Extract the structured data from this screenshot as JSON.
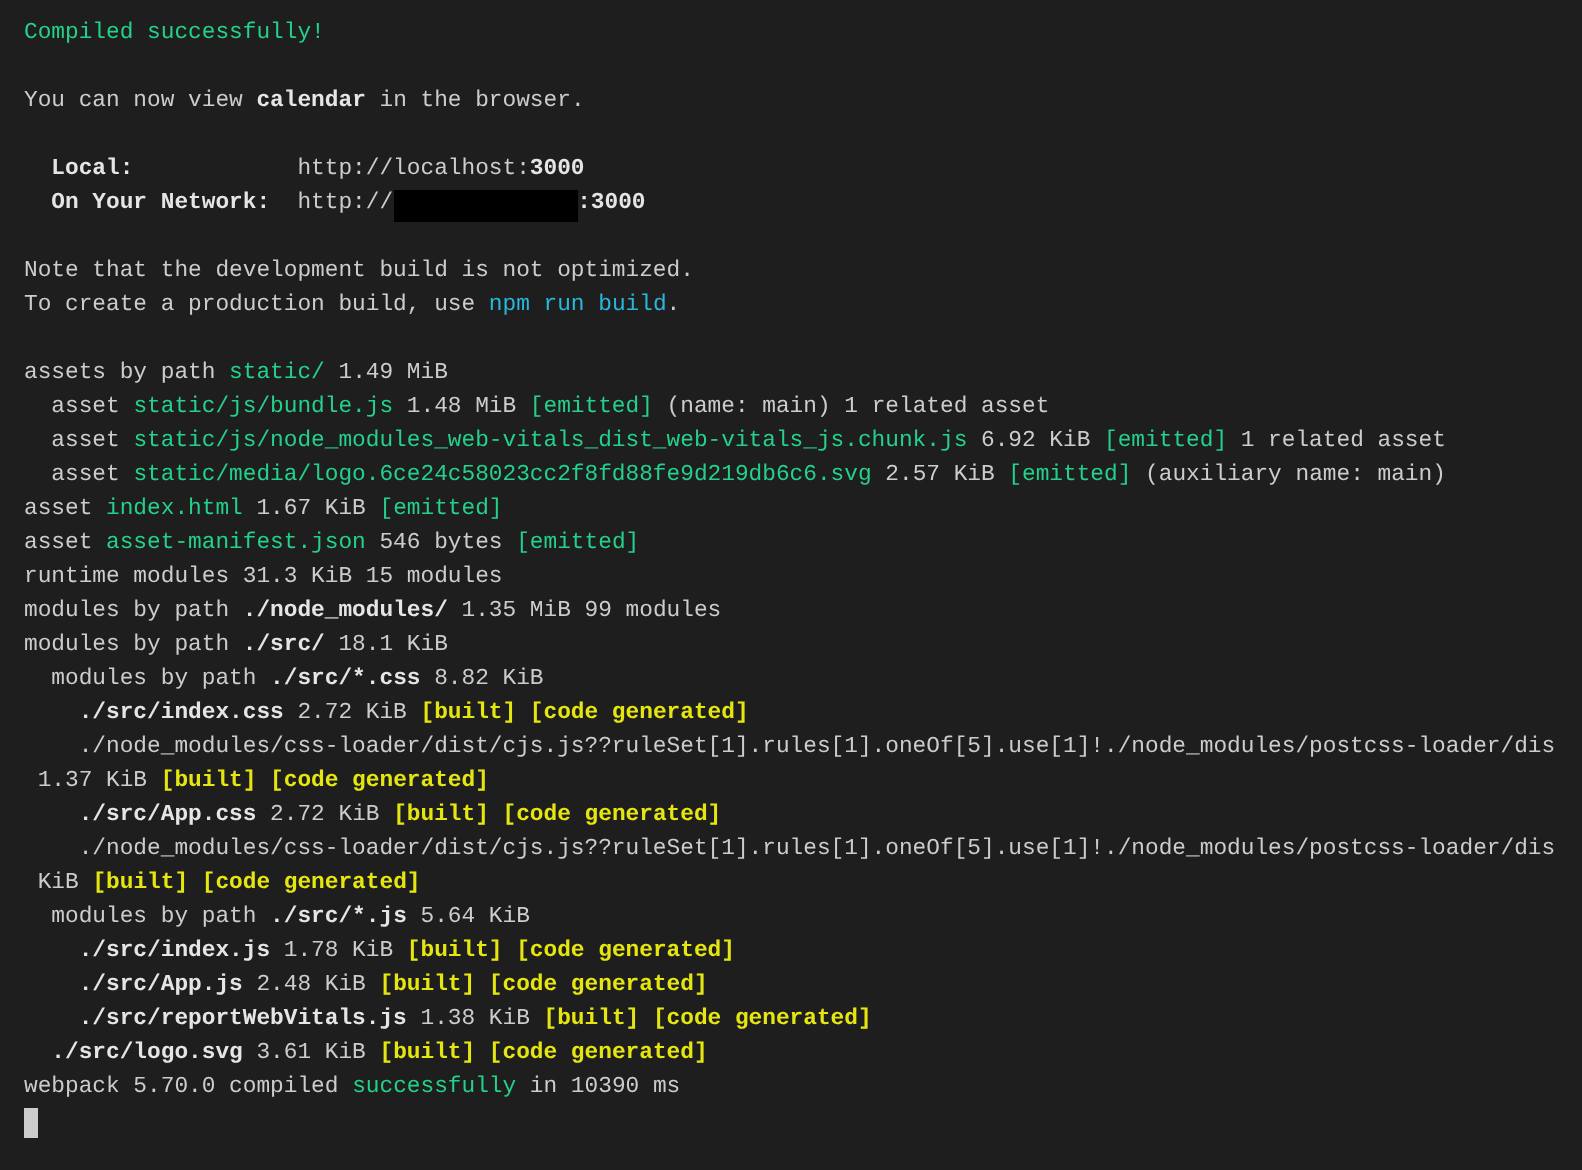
{
  "terminal": {
    "blocks": [
      [
        {
          "segments": [
            {
              "text": "Compiled successfully!",
              "kind": "green"
            }
          ]
        }
      ],
      [
        {
          "segments": [
            {
              "text": "You can now view ",
              "kind": "plain"
            },
            {
              "text": "calendar",
              "kind": "bold"
            },
            {
              "text": " in the browser.",
              "kind": "plain"
            }
          ]
        }
      ],
      [
        {
          "segments": [
            {
              "text": "  Local:",
              "kind": "bold"
            },
            {
              "text": "            http://localhost:",
              "kind": "plain"
            },
            {
              "text": "3000",
              "kind": "bold"
            }
          ]
        },
        {
          "segments": [
            {
              "text": "  On Your Network:",
              "kind": "bold"
            },
            {
              "text": "  http://",
              "kind": "plain"
            },
            {
              "kind": "redacted"
            },
            {
              "text": ":3000",
              "kind": "bold"
            }
          ]
        }
      ],
      [
        {
          "segments": [
            {
              "text": "Note that the development build is not optimized.",
              "kind": "plain"
            }
          ]
        },
        {
          "segments": [
            {
              "text": "To create a production build, use ",
              "kind": "plain"
            },
            {
              "text": "npm run build",
              "kind": "cyan"
            },
            {
              "text": ".",
              "kind": "plain"
            }
          ]
        }
      ],
      [
        {
          "segments": [
            {
              "text": "assets by path ",
              "kind": "plain"
            },
            {
              "text": "static/",
              "kind": "green"
            },
            {
              "text": " 1.49 MiB",
              "kind": "plain"
            }
          ]
        },
        {
          "segments": [
            {
              "text": "  asset ",
              "kind": "plain"
            },
            {
              "text": "static/js/bundle.js",
              "kind": "green"
            },
            {
              "text": " 1.48 MiB ",
              "kind": "plain"
            },
            {
              "text": "[emitted]",
              "kind": "green"
            },
            {
              "text": " (name: main) 1 related asset",
              "kind": "plain"
            }
          ]
        },
        {
          "segments": [
            {
              "text": "  asset ",
              "kind": "plain"
            },
            {
              "text": "static/js/node_modules_web-vitals_dist_web-vitals_js.chunk.js",
              "kind": "green"
            },
            {
              "text": " 6.92 KiB ",
              "kind": "plain"
            },
            {
              "text": "[emitted]",
              "kind": "green"
            },
            {
              "text": " 1 related asset",
              "kind": "plain"
            }
          ]
        },
        {
          "segments": [
            {
              "text": "  asset ",
              "kind": "plain"
            },
            {
              "text": "static/media/logo.6ce24c58023cc2f8fd88fe9d219db6c6.svg",
              "kind": "green"
            },
            {
              "text": " 2.57 KiB ",
              "kind": "plain"
            },
            {
              "text": "[emitted]",
              "kind": "green"
            },
            {
              "text": " (auxiliary name: main)",
              "kind": "plain"
            }
          ]
        },
        {
          "segments": [
            {
              "text": "asset ",
              "kind": "plain"
            },
            {
              "text": "index.html",
              "kind": "green"
            },
            {
              "text": " 1.67 KiB ",
              "kind": "plain"
            },
            {
              "text": "[emitted]",
              "kind": "green"
            }
          ]
        },
        {
          "segments": [
            {
              "text": "asset ",
              "kind": "plain"
            },
            {
              "text": "asset-manifest.json",
              "kind": "green"
            },
            {
              "text": " 546 bytes ",
              "kind": "plain"
            },
            {
              "text": "[emitted]",
              "kind": "green"
            }
          ]
        },
        {
          "segments": [
            {
              "text": "runtime modules 31.3 KiB 15 modules",
              "kind": "plain"
            }
          ]
        },
        {
          "segments": [
            {
              "text": "modules by path ",
              "kind": "plain"
            },
            {
              "text": "./node_modules/",
              "kind": "bold"
            },
            {
              "text": " 1.35 MiB 99 modules",
              "kind": "plain"
            }
          ]
        },
        {
          "segments": [
            {
              "text": "modules by path ",
              "kind": "plain"
            },
            {
              "text": "./src/",
              "kind": "bold"
            },
            {
              "text": " 18.1 KiB",
              "kind": "plain"
            }
          ]
        },
        {
          "segments": [
            {
              "text": "  modules by path ",
              "kind": "plain"
            },
            {
              "text": "./src/*.css",
              "kind": "bold"
            },
            {
              "text": " 8.82 KiB",
              "kind": "plain"
            }
          ]
        },
        {
          "segments": [
            {
              "text": "    ./src/index.css",
              "kind": "bold"
            },
            {
              "text": " 2.72 KiB ",
              "kind": "plain"
            },
            {
              "text": "[built] [code generated]",
              "kind": "yellow"
            }
          ]
        },
        {
          "segments": [
            {
              "text": "    ./node_modules/css-loader/dist/cjs.js??ruleSet[1].rules[1].oneOf[5].use[1]!./node_modules/postcss-loader/dis",
              "kind": "plain"
            }
          ]
        },
        {
          "segments": [
            {
              "text": " 1.37 KiB ",
              "kind": "plain"
            },
            {
              "text": "[built] [code generated]",
              "kind": "yellow"
            }
          ]
        },
        {
          "segments": [
            {
              "text": "    ./src/App.css",
              "kind": "bold"
            },
            {
              "text": " 2.72 KiB ",
              "kind": "plain"
            },
            {
              "text": "[built] [code generated]",
              "kind": "yellow"
            }
          ]
        },
        {
          "segments": [
            {
              "text": "    ./node_modules/css-loader/dist/cjs.js??ruleSet[1].rules[1].oneOf[5].use[1]!./node_modules/postcss-loader/dis",
              "kind": "plain"
            }
          ]
        },
        {
          "segments": [
            {
              "text": " KiB ",
              "kind": "plain"
            },
            {
              "text": "[built] [code generated]",
              "kind": "yellow"
            }
          ]
        },
        {
          "segments": [
            {
              "text": "  modules by path ",
              "kind": "plain"
            },
            {
              "text": "./src/*.js",
              "kind": "bold"
            },
            {
              "text": " 5.64 KiB",
              "kind": "plain"
            }
          ]
        },
        {
          "segments": [
            {
              "text": "    ./src/index.js",
              "kind": "bold"
            },
            {
              "text": " 1.78 KiB ",
              "kind": "plain"
            },
            {
              "text": "[built] [code generated]",
              "kind": "yellow"
            }
          ]
        },
        {
          "segments": [
            {
              "text": "    ./src/App.js",
              "kind": "bold"
            },
            {
              "text": " 2.48 KiB ",
              "kind": "plain"
            },
            {
              "text": "[built] [code generated]",
              "kind": "yellow"
            }
          ]
        },
        {
          "segments": [
            {
              "text": "    ./src/reportWebVitals.js",
              "kind": "bold"
            },
            {
              "text": " 1.38 KiB ",
              "kind": "plain"
            },
            {
              "text": "[built] [code generated]",
              "kind": "yellow"
            }
          ]
        },
        {
          "segments": [
            {
              "text": "  ./src/logo.svg",
              "kind": "bold"
            },
            {
              "text": " 3.61 KiB ",
              "kind": "plain"
            },
            {
              "text": "[built] [code generated]",
              "kind": "yellow"
            }
          ]
        },
        {
          "segments": [
            {
              "text": "webpack 5.70.0 compiled ",
              "kind": "plain"
            },
            {
              "text": "successfully",
              "kind": "green"
            },
            {
              "text": " in 10390 ms",
              "kind": "plain"
            }
          ]
        }
      ]
    ]
  }
}
